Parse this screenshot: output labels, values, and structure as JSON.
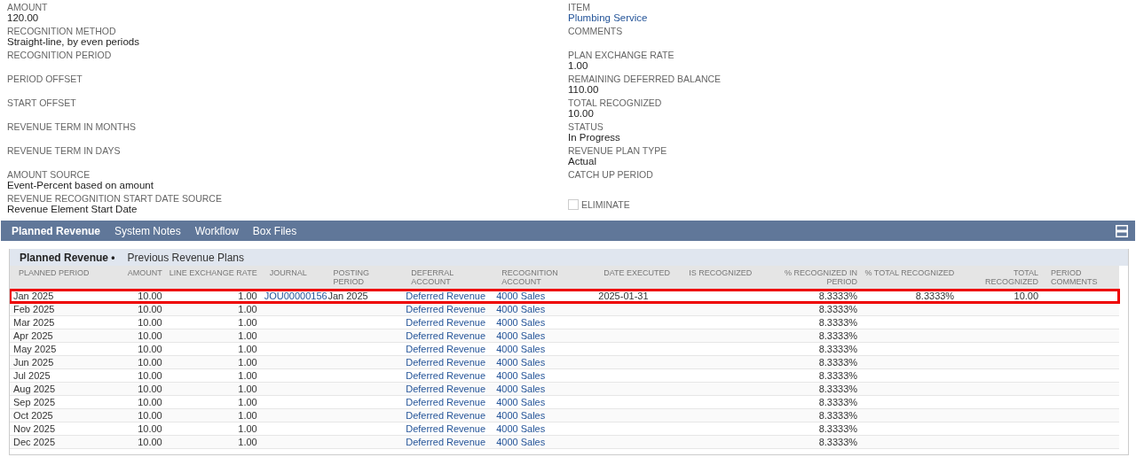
{
  "left_fields": [
    {
      "label": "AMOUNT",
      "value": "120.00"
    },
    {
      "label": "RECOGNITION METHOD",
      "value": "Straight-line, by even periods"
    },
    {
      "label": "RECOGNITION PERIOD"
    },
    {
      "label": "PERIOD OFFSET"
    },
    {
      "label": "START OFFSET"
    },
    {
      "label": "REVENUE TERM IN MONTHS"
    },
    {
      "label": "REVENUE TERM IN DAYS"
    },
    {
      "label": "AMOUNT SOURCE",
      "value": "Event-Percent based on amount"
    },
    {
      "label": "REVENUE RECOGNITION START DATE SOURCE",
      "value": "Revenue Element Start Date"
    }
  ],
  "right_fields": [
    {
      "label": "ITEM",
      "value": "Plumbing Service",
      "kind": "link"
    },
    {
      "label": "COMMENTS",
      "kind": "tall"
    },
    {
      "label": "PLAN EXCHANGE RATE",
      "value": "1.00"
    },
    {
      "label": "REMAINING DEFERRED BALANCE",
      "value": "110.00"
    },
    {
      "label": "TOTAL RECOGNIZED",
      "value": "10.00"
    },
    {
      "label": "STATUS",
      "value": "In Progress"
    },
    {
      "label": "REVENUE PLAN TYPE",
      "value": "Actual"
    },
    {
      "label": "CATCH UP PERIOD"
    }
  ],
  "eliminate": {
    "label": "ELIMINATE",
    "checked": false
  },
  "tabs": [
    {
      "label": "Planned Revenue",
      "selected": true
    },
    {
      "label": "System Notes",
      "selected": false
    },
    {
      "label": "Workflow",
      "selected": false
    },
    {
      "label": "Box Files",
      "selected": false
    }
  ],
  "subtabs": [
    {
      "label": "Planned Revenue •",
      "selected": true
    },
    {
      "label": "Previous Revenue Plans",
      "selected": false
    }
  ],
  "table": {
    "columns": [
      {
        "label": "PLANNED PERIOD",
        "kind": "text"
      },
      {
        "label": "AMOUNT",
        "kind": "number"
      },
      {
        "label": "LINE EXCHANGE RATE",
        "kind": "number"
      },
      {
        "label": "JOURNAL",
        "kind": "link"
      },
      {
        "label": "POSTING PERIOD",
        "kind": "text"
      },
      {
        "label": "DEFERRAL ACCOUNT",
        "kind": "link"
      },
      {
        "label": "RECOGNITION ACCOUNT",
        "kind": "link"
      },
      {
        "label": "DATE EXECUTED",
        "kind": "text"
      },
      {
        "label": "IS RECOGNIZED",
        "kind": "text"
      },
      {
        "label": "% RECOGNIZED IN PERIOD",
        "kind": "number"
      },
      {
        "label": "% TOTAL RECOGNIZED",
        "kind": "number"
      },
      {
        "label": "TOTAL RECOGNIZED",
        "kind": "number"
      },
      {
        "label": "PERIOD COMMENTS",
        "kind": "text"
      }
    ],
    "rows": [
      {
        "highlighted": true,
        "cells": [
          "Jan 2025",
          "10.00",
          "1.00",
          "JOU00000156",
          "Jan 2025",
          "Deferred Revenue",
          "4000 Sales",
          "2025-01-31",
          "",
          "8.3333%",
          "8.3333%",
          "10.00",
          ""
        ]
      },
      {
        "highlighted": false,
        "cells": [
          "Feb 2025",
          "10.00",
          "1.00",
          "",
          "",
          "Deferred Revenue",
          "4000 Sales",
          "",
          "",
          "8.3333%",
          "",
          "",
          ""
        ]
      },
      {
        "highlighted": false,
        "cells": [
          "Mar 2025",
          "10.00",
          "1.00",
          "",
          "",
          "Deferred Revenue",
          "4000 Sales",
          "",
          "",
          "8.3333%",
          "",
          "",
          ""
        ]
      },
      {
        "highlighted": false,
        "cells": [
          "Apr 2025",
          "10.00",
          "1.00",
          "",
          "",
          "Deferred Revenue",
          "4000 Sales",
          "",
          "",
          "8.3333%",
          "",
          "",
          ""
        ]
      },
      {
        "highlighted": false,
        "cells": [
          "May 2025",
          "10.00",
          "1.00",
          "",
          "",
          "Deferred Revenue",
          "4000 Sales",
          "",
          "",
          "8.3333%",
          "",
          "",
          ""
        ]
      },
      {
        "highlighted": false,
        "cells": [
          "Jun 2025",
          "10.00",
          "1.00",
          "",
          "",
          "Deferred Revenue",
          "4000 Sales",
          "",
          "",
          "8.3333%",
          "",
          "",
          ""
        ]
      },
      {
        "highlighted": false,
        "cells": [
          "Jul 2025",
          "10.00",
          "1.00",
          "",
          "",
          "Deferred Revenue",
          "4000 Sales",
          "",
          "",
          "8.3333%",
          "",
          "",
          ""
        ]
      },
      {
        "highlighted": false,
        "cells": [
          "Aug 2025",
          "10.00",
          "1.00",
          "",
          "",
          "Deferred Revenue",
          "4000 Sales",
          "",
          "",
          "8.3333%",
          "",
          "",
          ""
        ]
      },
      {
        "highlighted": false,
        "cells": [
          "Sep 2025",
          "10.00",
          "1.00",
          "",
          "",
          "Deferred Revenue",
          "4000 Sales",
          "",
          "",
          "8.3333%",
          "",
          "",
          ""
        ]
      },
      {
        "highlighted": false,
        "cells": [
          "Oct 2025",
          "10.00",
          "1.00",
          "",
          "",
          "Deferred Revenue",
          "4000 Sales",
          "",
          "",
          "8.3333%",
          "",
          "",
          ""
        ]
      },
      {
        "highlighted": false,
        "cells": [
          "Nov 2025",
          "10.00",
          "1.00",
          "",
          "",
          "Deferred Revenue",
          "4000 Sales",
          "",
          "",
          "8.3333%",
          "",
          "",
          ""
        ]
      },
      {
        "highlighted": false,
        "cells": [
          "Dec 2025",
          "10.00",
          "1.00",
          "",
          "",
          "Deferred Revenue",
          "4000 Sales",
          "",
          "",
          "8.3333%",
          "",
          "",
          ""
        ]
      }
    ]
  }
}
